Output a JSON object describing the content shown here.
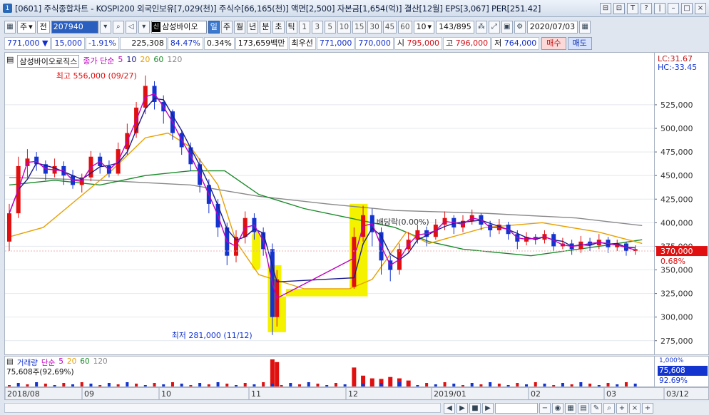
{
  "window": {
    "number": "1",
    "title": "[0601] 주식종합차트 - KOSPI200 외국인보유[7,029(천)] 주식수[66,165(천)] 액면[2,500] 자본금[1,654(억)] 결산[12월] EPS[3,067] PER[251.42]",
    "buttons": [
      "⊟",
      "⊡",
      "T",
      "?",
      "|",
      "–",
      "□",
      "×"
    ]
  },
  "toolbar": {
    "market_select": "주",
    "prev_label": "전",
    "code": "207940",
    "stock_badge": "신",
    "stock_name": "삼성바이오",
    "periods": [
      {
        "label": "일",
        "active": true
      },
      {
        "label": "주",
        "active": false
      },
      {
        "label": "월",
        "active": false
      },
      {
        "label": "년",
        "active": false
      },
      {
        "label": "분",
        "active": false
      },
      {
        "label": "초",
        "active": false
      },
      {
        "label": "틱",
        "active": false
      }
    ],
    "intervals": [
      "1",
      "3",
      "5",
      "10",
      "15",
      "30",
      "45",
      "60"
    ],
    "interval_select": "10",
    "count": "143",
    "count_total": "/895",
    "date": "2020/07/03"
  },
  "quote": {
    "price": "771,000",
    "change_arrow": "▼",
    "change": "15,000",
    "change_pct": "-1.91%",
    "volume": "225,308",
    "vol_ratio": "84.47%",
    "turnover": "0.34%",
    "amount": "173,659백만",
    "best_ask_label": "최우선",
    "best_ask": "771,000",
    "best_bid": "770,000",
    "open_label": "시",
    "open": "795,000",
    "high_label": "고",
    "high": "796,000",
    "low_label": "저",
    "low": "764,000",
    "buy_button": "매수",
    "sell_button": "매도"
  },
  "legend": {
    "name": "삼성바이오로직스",
    "series_label": "종가 단순",
    "ma": [
      {
        "label": "5",
        "color": "#c000c0"
      },
      {
        "label": "10",
        "color": "#1a1a8c"
      },
      {
        "label": "20",
        "color": "#e8a000"
      },
      {
        "label": "60",
        "color": "#1a8a2a"
      },
      {
        "label": "120",
        "color": "#888888"
      }
    ]
  },
  "vol_legend": {
    "name": "거래량",
    "series_label": "단순",
    "ma": [
      "5",
      "20",
      "60",
      "120"
    ],
    "value": "75,608주(92,69%)"
  },
  "annotations": {
    "high": "최고 556,000 (09/27)",
    "low": "최저 281,000 (11/12)",
    "dividend": "배당락(0.00%)"
  },
  "yaxis": {
    "lc": "LC:31.67",
    "hc": "HC:-33.45",
    "ticks": [
      "525,000",
      "500,000",
      "475,000",
      "450,000",
      "425,000",
      "400,000",
      "375,000",
      "350,000",
      "325,000",
      "300,000",
      "275,000"
    ],
    "current_price": "370,000",
    "current_pct": "0.68%",
    "vol_label": "1,000%",
    "vol_current": "75,608",
    "vol_pct": "92.69%"
  },
  "xaxis": {
    "labels": [
      "2018/08",
      "09",
      "10",
      "11",
      "12",
      "2019/01",
      "02",
      "03",
      "03/12"
    ]
  },
  "colors": {
    "up": "#e01010",
    "down": "#1434d0",
    "ma5": "#c000c0",
    "ma10": "#1a1a8c",
    "ma20": "#e8a000",
    "ma60": "#1a8a2a",
    "ma120": "#888888",
    "highlight": "#f5f200"
  },
  "chart_data": {
    "type": "candlestick",
    "ylim": [
      265000,
      565000
    ],
    "yticks": [
      275000,
      300000,
      325000,
      350000,
      375000,
      400000,
      425000,
      450000,
      475000,
      500000,
      525000
    ],
    "x_labels": [
      "2018/08",
      "09",
      "10",
      "11",
      "12",
      "2019/01",
      "02",
      "03"
    ],
    "high_point": {
      "date": "09/27",
      "value": 556000
    },
    "low_point": {
      "date": "11/12",
      "value": 281000
    },
    "last_close": 370000,
    "ma20": [
      [
        0,
        385000
      ],
      [
        15,
        395000
      ],
      [
        30,
        425000
      ],
      [
        45,
        455000
      ],
      [
        60,
        490000
      ],
      [
        70,
        495000
      ],
      [
        80,
        480000
      ],
      [
        92,
        440000
      ],
      [
        100,
        380000
      ],
      [
        110,
        345000
      ],
      [
        130,
        330000
      ],
      [
        150,
        330000
      ],
      [
        160,
        340000
      ],
      [
        175,
        390000
      ],
      [
        185,
        378000
      ],
      [
        210,
        395000
      ],
      [
        235,
        400000
      ],
      [
        260,
        390000
      ],
      [
        279,
        378000
      ]
    ],
    "ma60": [
      [
        0,
        440000
      ],
      [
        20,
        445000
      ],
      [
        40,
        440000
      ],
      [
        60,
        450000
      ],
      [
        80,
        455000
      ],
      [
        95,
        455000
      ],
      [
        110,
        430000
      ],
      [
        130,
        415000
      ],
      [
        150,
        405000
      ],
      [
        170,
        395000
      ],
      [
        185,
        380000
      ],
      [
        200,
        372000
      ],
      [
        230,
        365000
      ],
      [
        260,
        375000
      ],
      [
        279,
        382000
      ]
    ],
    "ma120": [
      [
        0,
        448000
      ],
      [
        40,
        445000
      ],
      [
        80,
        440000
      ],
      [
        110,
        428000
      ],
      [
        140,
        420000
      ],
      [
        170,
        413000
      ],
      [
        210,
        410000
      ],
      [
        250,
        405000
      ],
      [
        279,
        397000
      ]
    ],
    "candles": [
      [
        0,
        380000,
        410000,
        420000,
        370000
      ],
      [
        4,
        410000,
        460000,
        470000,
        405000
      ],
      [
        8,
        460000,
        468000,
        478000,
        448000
      ],
      [
        12,
        470000,
        462000,
        475000,
        455000
      ],
      [
        16,
        462000,
        452000,
        466000,
        445000
      ],
      [
        20,
        452000,
        460000,
        468000,
        448000
      ],
      [
        24,
        460000,
        450000,
        465000,
        440000
      ],
      [
        28,
        450000,
        440000,
        456000,
        436000
      ],
      [
        32,
        440000,
        448000,
        452000,
        432000
      ],
      [
        36,
        448000,
        470000,
        476000,
        444000
      ],
      [
        40,
        470000,
        460000,
        474000,
        452000
      ],
      [
        44,
        460000,
        452000,
        466000,
        448000
      ],
      [
        48,
        452000,
        478000,
        485000,
        450000
      ],
      [
        52,
        478000,
        495000,
        505000,
        472000
      ],
      [
        56,
        495000,
        522000,
        528000,
        490000
      ],
      [
        60,
        522000,
        545000,
        556000,
        515000
      ],
      [
        64,
        545000,
        528000,
        550000,
        520000
      ],
      [
        68,
        528000,
        518000,
        535000,
        505000
      ],
      [
        72,
        518000,
        495000,
        520000,
        488000
      ],
      [
        76,
        495000,
        480000,
        498000,
        472000
      ],
      [
        80,
        480000,
        462000,
        485000,
        455000
      ],
      [
        84,
        462000,
        440000,
        468000,
        432000
      ],
      [
        88,
        440000,
        420000,
        446000,
        410000
      ],
      [
        92,
        420000,
        395000,
        425000,
        385000
      ],
      [
        96,
        395000,
        365000,
        400000,
        355000
      ],
      [
        100,
        365000,
        385000,
        392000,
        358000
      ],
      [
        104,
        385000,
        405000,
        412000,
        378000
      ],
      [
        108,
        405000,
        390000,
        410000,
        382000
      ],
      [
        112,
        390000,
        372000,
        395000,
        365000
      ],
      [
        116,
        372000,
        300000,
        378000,
        281000
      ],
      [
        118,
        300000,
        340000,
        350000,
        290000
      ],
      [
        152,
        332000,
        385000,
        395000,
        330000
      ],
      [
        156,
        385000,
        408000,
        418000,
        380000
      ],
      [
        160,
        408000,
        390000,
        415000,
        375000
      ],
      [
        164,
        390000,
        360000,
        395000,
        345000
      ],
      [
        168,
        360000,
        350000,
        365000,
        338000
      ],
      [
        172,
        350000,
        372000,
        378000,
        345000
      ],
      [
        176,
        372000,
        382000,
        390000,
        368000
      ],
      [
        180,
        382000,
        392000,
        398000,
        378000
      ],
      [
        184,
        392000,
        385000,
        396000,
        375000
      ],
      [
        188,
        385000,
        398000,
        404000,
        382000
      ],
      [
        192,
        398000,
        405000,
        412000,
        392000
      ],
      [
        196,
        405000,
        395000,
        408000,
        388000
      ],
      [
        200,
        395000,
        402000,
        408000,
        390000
      ],
      [
        204,
        402000,
        408000,
        414000,
        398000
      ],
      [
        208,
        408000,
        398000,
        410000,
        392000
      ],
      [
        212,
        398000,
        392000,
        402000,
        385000
      ],
      [
        216,
        392000,
        398000,
        404000,
        388000
      ],
      [
        220,
        398000,
        388000,
        401000,
        382000
      ],
      [
        224,
        388000,
        380000,
        392000,
        372000
      ],
      [
        228,
        380000,
        385000,
        390000,
        376000
      ],
      [
        232,
        385000,
        382000,
        388000,
        377000
      ],
      [
        236,
        382000,
        388000,
        392000,
        378000
      ],
      [
        240,
        388000,
        375000,
        390000,
        370000
      ],
      [
        244,
        375000,
        378000,
        384000,
        372000
      ],
      [
        248,
        378000,
        372000,
        382000,
        366000
      ],
      [
        252,
        372000,
        380000,
        386000,
        368000
      ],
      [
        256,
        380000,
        376000,
        384000,
        370000
      ],
      [
        260,
        376000,
        382000,
        388000,
        372000
      ],
      [
        264,
        382000,
        374000,
        385000,
        368000
      ],
      [
        268,
        374000,
        378000,
        382000,
        370000
      ],
      [
        272,
        378000,
        370000,
        380000,
        365000
      ],
      [
        276,
        370000,
        372000,
        376000,
        366000
      ]
    ],
    "volume": [
      [
        116,
        1000
      ],
      [
        118,
        900
      ],
      [
        152,
        700
      ],
      [
        156,
        400
      ],
      [
        160,
        300
      ],
      [
        164,
        280
      ],
      [
        168,
        350
      ],
      [
        172,
        300
      ],
      [
        176,
        220
      ]
    ]
  }
}
